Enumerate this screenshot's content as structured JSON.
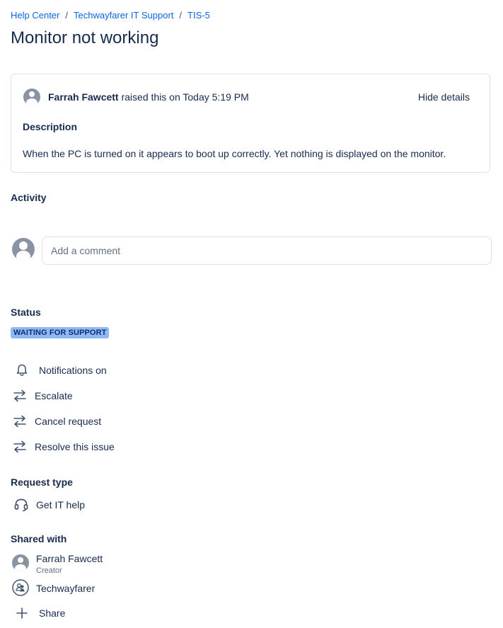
{
  "breadcrumb": {
    "items": [
      "Help Center",
      "Techwayfarer IT Support",
      "TIS-5"
    ],
    "separator": "/"
  },
  "request": {
    "title": "Monitor not working",
    "reporter": "Farrah Fawcett",
    "raised_text": "raised this on Today 5:19 PM",
    "hide_details_label": "Hide details",
    "description_heading": "Description",
    "description": "When the PC is turned on it appears to boot up correctly. Yet nothing is displayed on the monitor."
  },
  "activity": {
    "heading": "Activity",
    "comment_placeholder": "Add a comment"
  },
  "status": {
    "heading": "Status",
    "value": "WAITING FOR SUPPORT",
    "color": "#8fb8f6"
  },
  "actions": {
    "notifications": "Notifications on",
    "escalate": "Escalate",
    "cancel": "Cancel request",
    "resolve": "Resolve this issue"
  },
  "request_type": {
    "heading": "Request type",
    "value": "Get IT help"
  },
  "shared_with": {
    "heading": "Shared with",
    "people": [
      {
        "name": "Farrah Fawcett",
        "role": "Creator"
      },
      {
        "name": "Techwayfarer"
      }
    ],
    "share_label": "Share"
  }
}
